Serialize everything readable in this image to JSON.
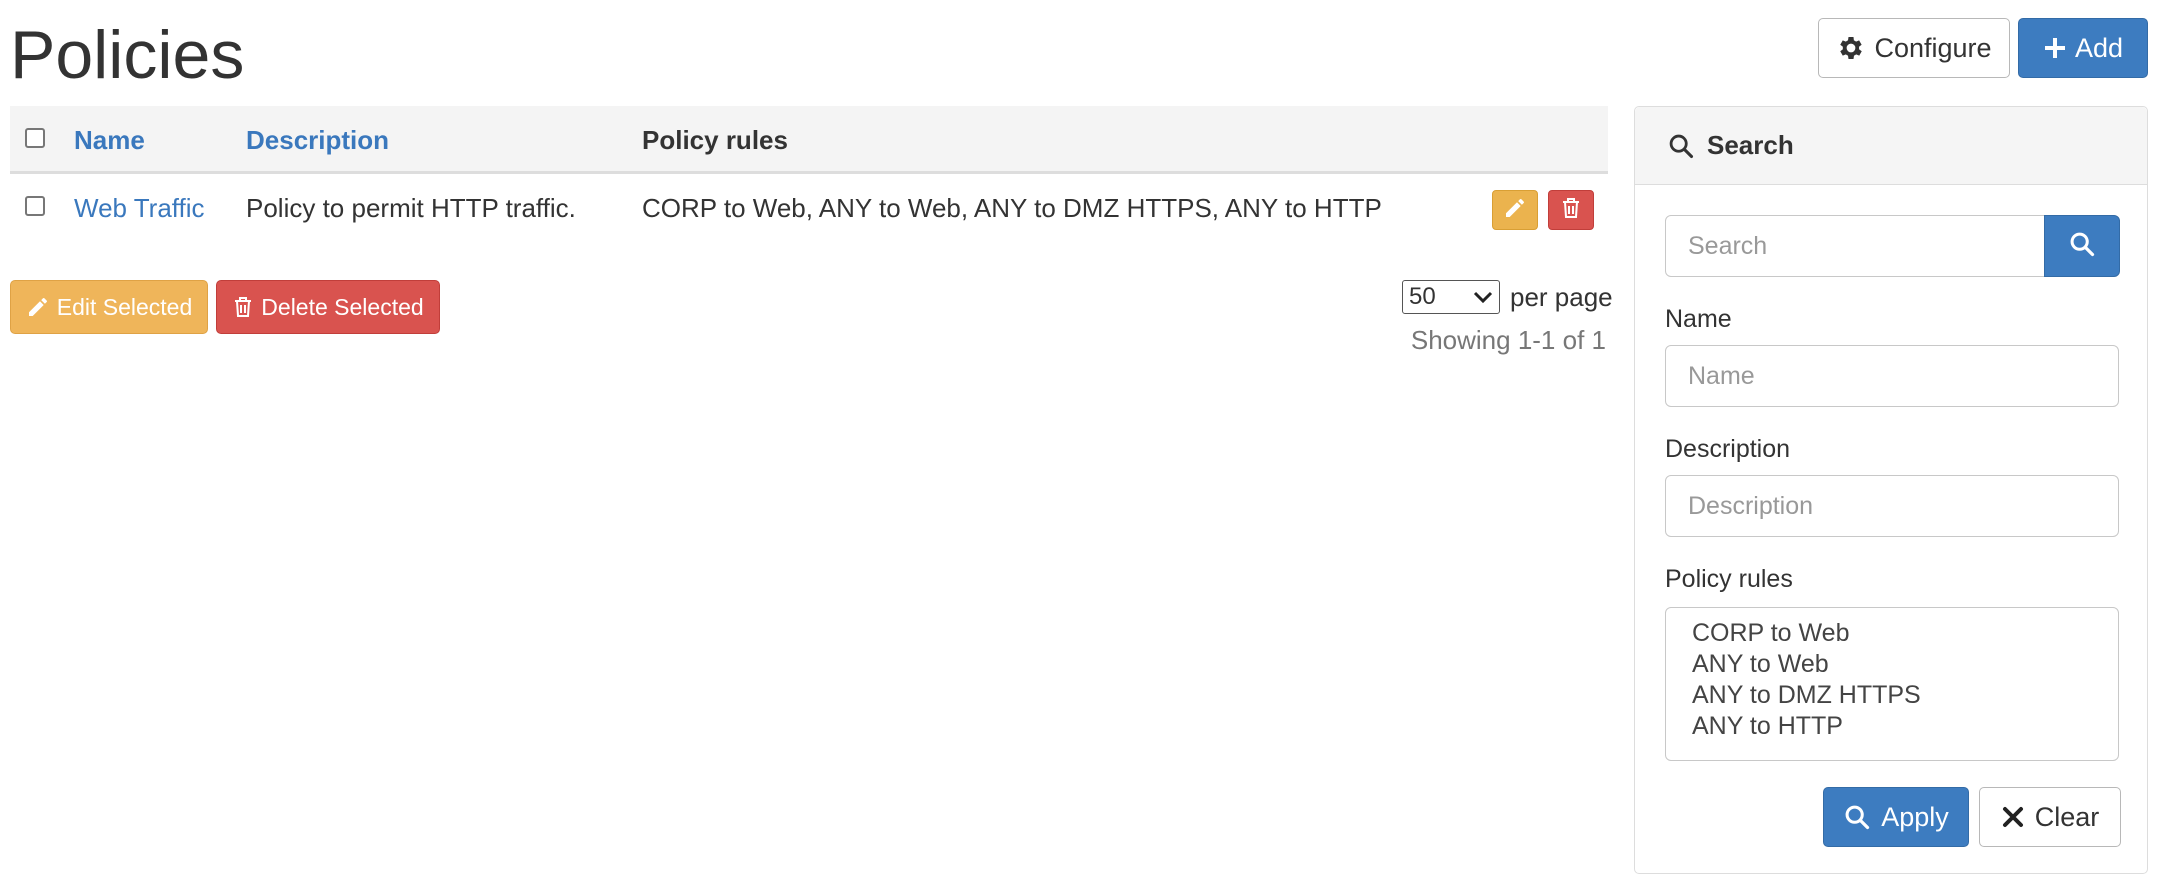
{
  "page": {
    "title": "Policies"
  },
  "toolbar": {
    "configure_label": "Configure",
    "add_label": "Add"
  },
  "table": {
    "columns": [
      "Name",
      "Description",
      "Policy rules"
    ],
    "rows": [
      {
        "name": "Web Traffic",
        "description": "Policy to permit HTTP traffic.",
        "policy_rules": "CORP to Web, ANY to Web, ANY to DMZ HTTPS, ANY to HTTP"
      }
    ]
  },
  "bulk_actions": {
    "edit_label": "Edit Selected",
    "delete_label": "Delete Selected"
  },
  "pagination": {
    "per_page_value": "50",
    "per_page_label": "per page",
    "showing": "Showing 1-1 of 1"
  },
  "search_panel": {
    "title": "Search",
    "search_placeholder": "Search",
    "name_label": "Name",
    "name_placeholder": "Name",
    "description_label": "Description",
    "description_placeholder": "Description",
    "policy_rules_label": "Policy rules",
    "policy_rules_options": [
      "CORP to Web",
      "ANY to Web",
      "ANY to DMZ HTTPS",
      "ANY to HTTP"
    ],
    "apply_label": "Apply",
    "clear_label": "Clear"
  },
  "colors": {
    "primary": "#3d7cc0",
    "warning": "#efb55a",
    "danger": "#d9534f",
    "link": "#3a78bd"
  },
  "icons": [
    "gear-icon",
    "plus-icon",
    "pencil-icon",
    "trash-icon",
    "search-icon",
    "close-icon",
    "chevron-down-icon"
  ]
}
